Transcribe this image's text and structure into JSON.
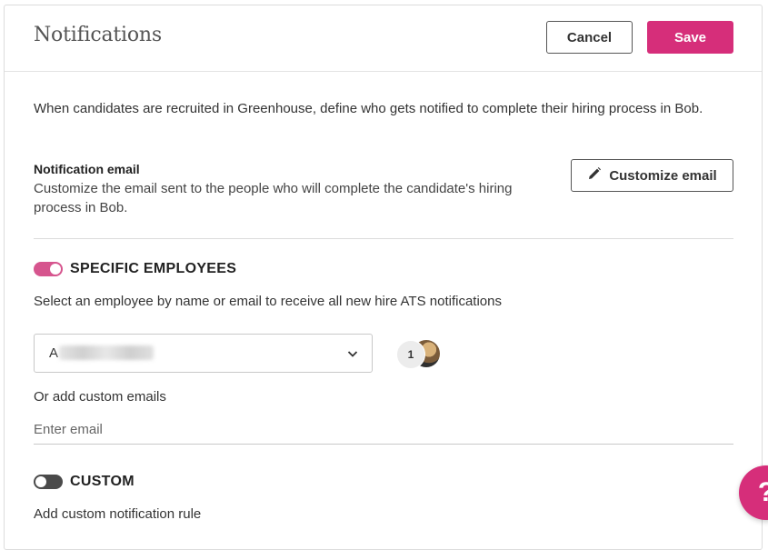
{
  "header": {
    "title": "Notifications",
    "cancel_label": "Cancel",
    "save_label": "Save"
  },
  "intro_text": "When candidates are recruited in Greenhouse, define who gets notified to complete their hiring process in Bob.",
  "notification_email": {
    "title": "Notification email",
    "description": "Customize the email sent to the people who will complete the candidate's hiring process in Bob.",
    "customize_label": "Customize email"
  },
  "specific_employees": {
    "enabled": true,
    "label": "SPECIFIC EMPLOYEES",
    "helper": "Select an employee by name or email to receive all new hire ATS notifications",
    "select_value": "A",
    "selected_count": "1",
    "custom_emails_label": "Or add custom emails",
    "email_placeholder": "Enter email"
  },
  "custom": {
    "enabled": false,
    "label": "CUSTOM",
    "helper": "Add custom notification rule"
  },
  "help_button": {
    "label": "?"
  },
  "colors": {
    "accent": "#d62e7a",
    "toggle_on": "#d6558e",
    "toggle_off": "#4a4a4a"
  }
}
